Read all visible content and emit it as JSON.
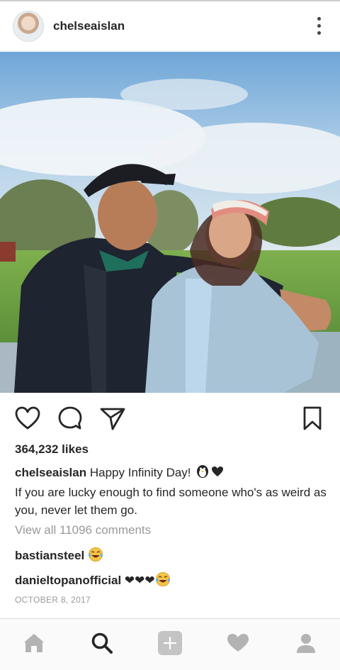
{
  "post": {
    "username": "chelseaislan",
    "likes": "364,232 likes",
    "caption_username": "chelseaislan",
    "caption_text_1": "Happy Infinity Day! ",
    "caption_text_2": "If you are lucky enough to find someone who's as weird as you, never let them go.",
    "view_all_comments": "View all 11096 comments",
    "comments": [
      {
        "username": "bastiansteel",
        "text": ""
      },
      {
        "username": "danieltopanofficial",
        "text": "❤❤❤"
      }
    ],
    "date": "OCTOBER 8, 2017"
  },
  "icons": {
    "header_menu": "more-vertical-icon",
    "like": "heart-outline-icon",
    "comment": "comment-bubble-icon",
    "share": "paper-plane-icon",
    "save": "bookmark-icon",
    "emoji_1": "penguin-emoji",
    "emoji_2": "heart-emoji",
    "emoji_3": "tears-of-joy-emoji",
    "tab_home": "home-icon",
    "tab_search": "search-icon",
    "tab_add": "add-post-icon",
    "tab_activity": "heart-filled-icon",
    "tab_profile": "profile-icon"
  },
  "colors": {
    "text": "#262626",
    "muted": "#999999",
    "inactive_tab": "#b3b3b3",
    "active_tab": "#262626"
  }
}
